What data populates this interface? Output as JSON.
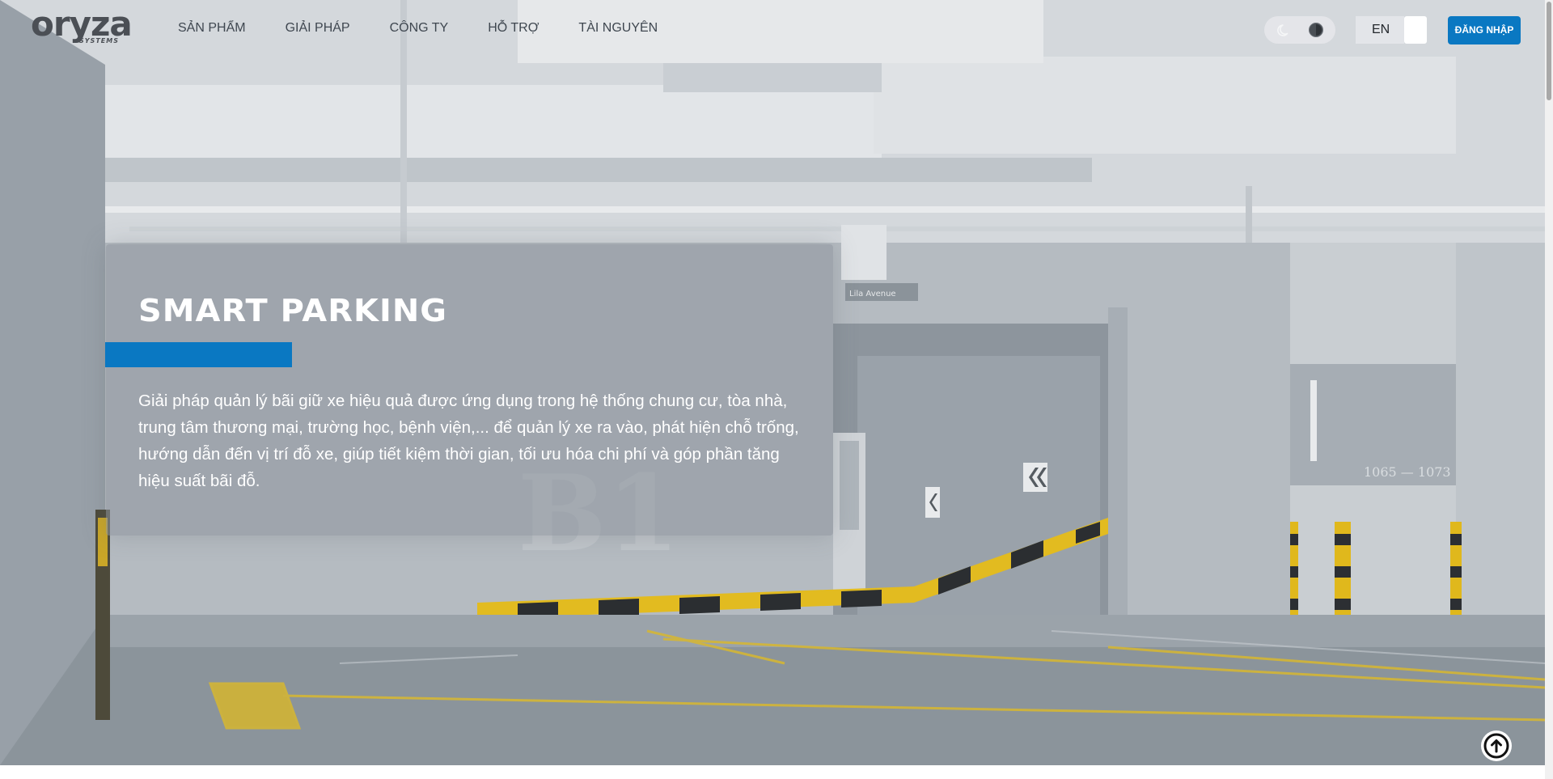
{
  "logo": {
    "word": "oryza",
    "sub": "SYSTEMS"
  },
  "nav": {
    "items": [
      {
        "label": "SẢN PHẨM"
      },
      {
        "label": "GIẢI PHÁP"
      },
      {
        "label": "CÔNG TY"
      },
      {
        "label": "HỖ TRỢ"
      },
      {
        "label": "TÀI NGUYÊN"
      }
    ]
  },
  "header": {
    "theme_icons": [
      "moon-icon",
      "contrast-icon"
    ],
    "language": "EN",
    "login_label": "ĐĂNG NHẬP"
  },
  "hero": {
    "title": "SMART PARKING",
    "description": "Giải pháp quản lý bãi giữ xe hiệu quả được ứng dụng trong hệ thống chung cư, tòa nhà, trung tâm thương mại, trường học, bệnh viện,... để quản lý xe ra vào, phát hiện chỗ trống, hướng dẫn đến vị trí đỗ xe, giúp tiết kiệm thời gian, tối ưu hóa chi phí và góp phần tăng hiệu suất bãi đỗ.",
    "background_labels": {
      "floor_mark": "B1",
      "pillar_sign": "1065 — 1073",
      "street_sign": "Lila Avenue"
    }
  },
  "colors": {
    "accent": "#0a78c2",
    "hazard_yellow": "#e8c020",
    "nav_text": "#3f4750"
  },
  "scroll_top_icon": "arrow-up-circle-icon"
}
